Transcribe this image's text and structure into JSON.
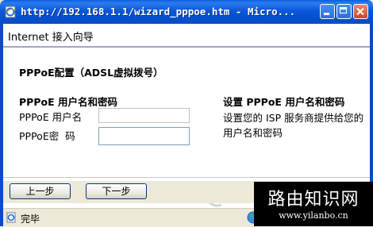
{
  "window": {
    "title": "http://192.168.1.1/wizard_pppoe.htm - Micro...",
    "title_bar_color": "#0a58d8",
    "icon": "ie-page-icon",
    "controls": [
      "minimize-icon",
      "maximize-icon",
      "close-icon"
    ]
  },
  "wizard": {
    "title": "Internet 接入向导",
    "section_title": "PPPoE配置（ADSL虚拟拨号）",
    "group_title": "PPPoE 用户名和密码",
    "username_label": "PPPoE 用户名",
    "username_value": "",
    "password_label": "PPPoE密  码",
    "password_value": "",
    "help_title": "设置 PPPoE 用户名和密码",
    "help_text": "设置您的 ISP 服务商提供给您的用户名和密码",
    "back_button": "上一步",
    "next_button": "下一步"
  },
  "statusbar": {
    "text": "完毕",
    "page_icon": "done-page-icon",
    "zone_icon": "internet-zone-icon"
  },
  "watermark": {
    "main": "路由知识网",
    "url": "www.yilanbo.cn"
  }
}
